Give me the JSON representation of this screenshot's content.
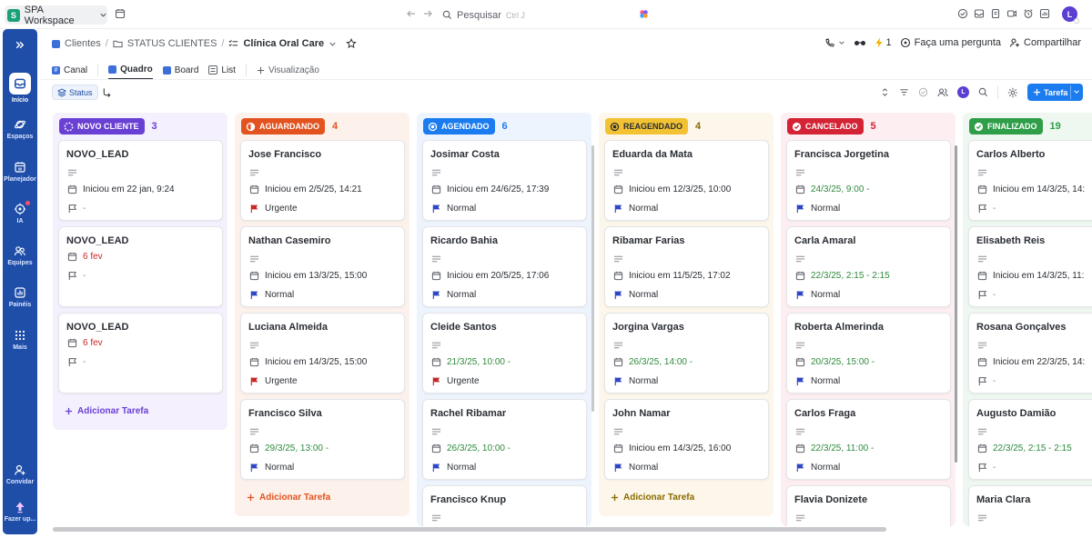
{
  "workspace": {
    "logo_letter": "S",
    "name": "SPA Workspace"
  },
  "search": {
    "placeholder": "Pesquisar",
    "shortcut": "Ctrl J"
  },
  "user": {
    "initial": "L"
  },
  "sidebar": {
    "items": [
      {
        "label": "Início",
        "icon": "home-icon"
      },
      {
        "label": "Espaços",
        "icon": "planet-icon"
      },
      {
        "label": "Planejador",
        "icon": "calendar-icon"
      },
      {
        "label": "IA",
        "icon": "ai-icon"
      },
      {
        "label": "Equipes",
        "icon": "team-icon"
      },
      {
        "label": "Painéis",
        "icon": "dashboard-icon"
      },
      {
        "label": "Mais",
        "icon": "grid-icon"
      },
      {
        "label": "Convidar",
        "icon": "invite-icon"
      },
      {
        "label": "Fazer up...",
        "icon": "upgrade-icon"
      }
    ]
  },
  "breadcrumb": {
    "items": [
      "Clientes",
      "STATUS CLIENTES",
      "Clínica Oral Care"
    ]
  },
  "header_actions": {
    "ai_count": "1",
    "ask": "Faça uma pergunta",
    "share": "Compartilhar"
  },
  "tabs": [
    {
      "label": "Canal"
    },
    {
      "label": "Quadro"
    },
    {
      "label": "Board"
    },
    {
      "label": "List"
    },
    {
      "label": "Visualização"
    }
  ],
  "toolbar": {
    "group_chip": "Status",
    "add_task": "Tarefa"
  },
  "board": {
    "add_task_label": "Adicionar Tarefa",
    "columns": [
      {
        "status": "NOVO CLIENTE",
        "count": "3",
        "color": "#6a3fd4",
        "bg": "#f4f0fd",
        "icon": "dashed-circle-icon",
        "cards": [
          {
            "title": "NOVO_LEAD",
            "date": "Iniciou em 22 jan, 9:24",
            "date_tone": "",
            "priority": "-",
            "flag": "empty"
          },
          {
            "title": "NOVO_LEAD",
            "date": "6 fev",
            "date_tone": "red",
            "priority": "-",
            "flag": "empty",
            "no_desc": true
          },
          {
            "title": "NOVO_LEAD",
            "date": "6 fev",
            "date_tone": "red",
            "priority": "-",
            "flag": "empty",
            "no_desc": true
          }
        ]
      },
      {
        "status": "AGUARDANDO",
        "count": "4",
        "color": "#e2531f",
        "bg": "#fdf1ec",
        "icon": "half-circle-icon",
        "cards": [
          {
            "title": "Jose Francisco",
            "date": "Iniciou em 2/5/25, 14:21",
            "date_tone": "",
            "priority": "Urgente",
            "flag": "red"
          },
          {
            "title": "Nathan Casemiro",
            "date": "Iniciou em 13/3/25, 15:00",
            "date_tone": "",
            "priority": "Normal",
            "flag": "blue"
          },
          {
            "title": "Luciana Almeida",
            "date": "Iniciou em 14/3/25, 15:00",
            "date_tone": "",
            "priority": "Urgente",
            "flag": "red"
          },
          {
            "title": "Francisco Silva",
            "date": "29/3/25, 13:00 -",
            "date_tone": "green",
            "priority": "Normal",
            "flag": "blue"
          }
        ]
      },
      {
        "status": "AGENDADO",
        "count": "6",
        "color": "#1b7cf0",
        "bg": "#eef4fd",
        "icon": "target-icon",
        "cards": [
          {
            "title": "Josimar Costa",
            "date": "Iniciou em 24/6/25, 17:39",
            "date_tone": "",
            "priority": "Normal",
            "flag": "blue"
          },
          {
            "title": "Ricardo Bahia",
            "date": "Iniciou em 20/5/25, 17:06",
            "date_tone": "",
            "priority": "Normal",
            "flag": "blue"
          },
          {
            "title": "Cleide Santos",
            "date": "21/3/25, 10:00 -",
            "date_tone": "green",
            "priority": "Urgente",
            "flag": "red"
          },
          {
            "title": "Rachel Ribamar",
            "date": "26/3/25, 10:00 -",
            "date_tone": "green",
            "priority": "Normal",
            "flag": "blue"
          },
          {
            "title": "Francisco Knup",
            "date": "",
            "date_tone": "",
            "priority": "",
            "flag": "none"
          }
        ]
      },
      {
        "status": "REAGENDADO",
        "count": "4",
        "color": "#f2c233",
        "bg": "#fdf6ea",
        "icon": "record-icon",
        "cards": [
          {
            "title": "Eduarda da Mata",
            "date": "Iniciou em 12/3/25, 10:00",
            "date_tone": "",
            "priority": "Normal",
            "flag": "blue"
          },
          {
            "title": "Ribamar Farias",
            "date": "Iniciou em 11/5/25, 17:02",
            "date_tone": "",
            "priority": "Normal",
            "flag": "blue"
          },
          {
            "title": "Jorgina Vargas",
            "date": "26/3/25, 14:00 -",
            "date_tone": "green",
            "priority": "Normal",
            "flag": "blue"
          },
          {
            "title": "John Namar",
            "date": "Iniciou em 14/3/25, 16:00",
            "date_tone": "",
            "priority": "Normal",
            "flag": "blue"
          }
        ]
      },
      {
        "status": "CANCELADO",
        "count": "5",
        "color": "#d32334",
        "bg": "#fdeff1",
        "icon": "check-circle-icon",
        "cards": [
          {
            "title": "Francisca Jorgetina",
            "date": "24/3/25, 9:00 -",
            "date_tone": "green",
            "priority": "Normal",
            "flag": "blue"
          },
          {
            "title": "Carla Amaral",
            "date": "22/3/25, 2:15 - 2:15",
            "date_tone": "green",
            "priority": "Normal",
            "flag": "blue"
          },
          {
            "title": "Roberta Almerinda",
            "date": "20/3/25, 15:00 -",
            "date_tone": "green",
            "priority": "Normal",
            "flag": "blue"
          },
          {
            "title": "Carlos Fraga",
            "date": "22/3/25, 11:00 -",
            "date_tone": "green",
            "priority": "Normal",
            "flag": "blue"
          },
          {
            "title": "Flavia Donizete",
            "date": "",
            "date_tone": "",
            "priority": "",
            "flag": "none"
          }
        ]
      },
      {
        "status": "FINALIZADO",
        "count": "19",
        "color": "#2e9e48",
        "bg": "#eef7f0",
        "icon": "check-circle-icon",
        "cards": [
          {
            "title": "Carlos Alberto",
            "date": "Iniciou em 14/3/25, 14:",
            "date_tone": "",
            "priority": "-",
            "flag": "empty"
          },
          {
            "title": "Elisabeth Reis",
            "date": "Iniciou em 14/3/25, 11:",
            "date_tone": "",
            "priority": "-",
            "flag": "empty"
          },
          {
            "title": "Rosana Gonçalves",
            "date": "Iniciou em 22/3/25, 14:",
            "date_tone": "",
            "priority": "-",
            "flag": "empty"
          },
          {
            "title": "Augusto Damião",
            "date": "22/3/25, 2:15 - 2:15",
            "date_tone": "green",
            "priority": "-",
            "flag": "empty"
          },
          {
            "title": "Maria Clara",
            "date": "",
            "date_tone": "",
            "priority": "",
            "flag": "none"
          }
        ]
      }
    ]
  }
}
